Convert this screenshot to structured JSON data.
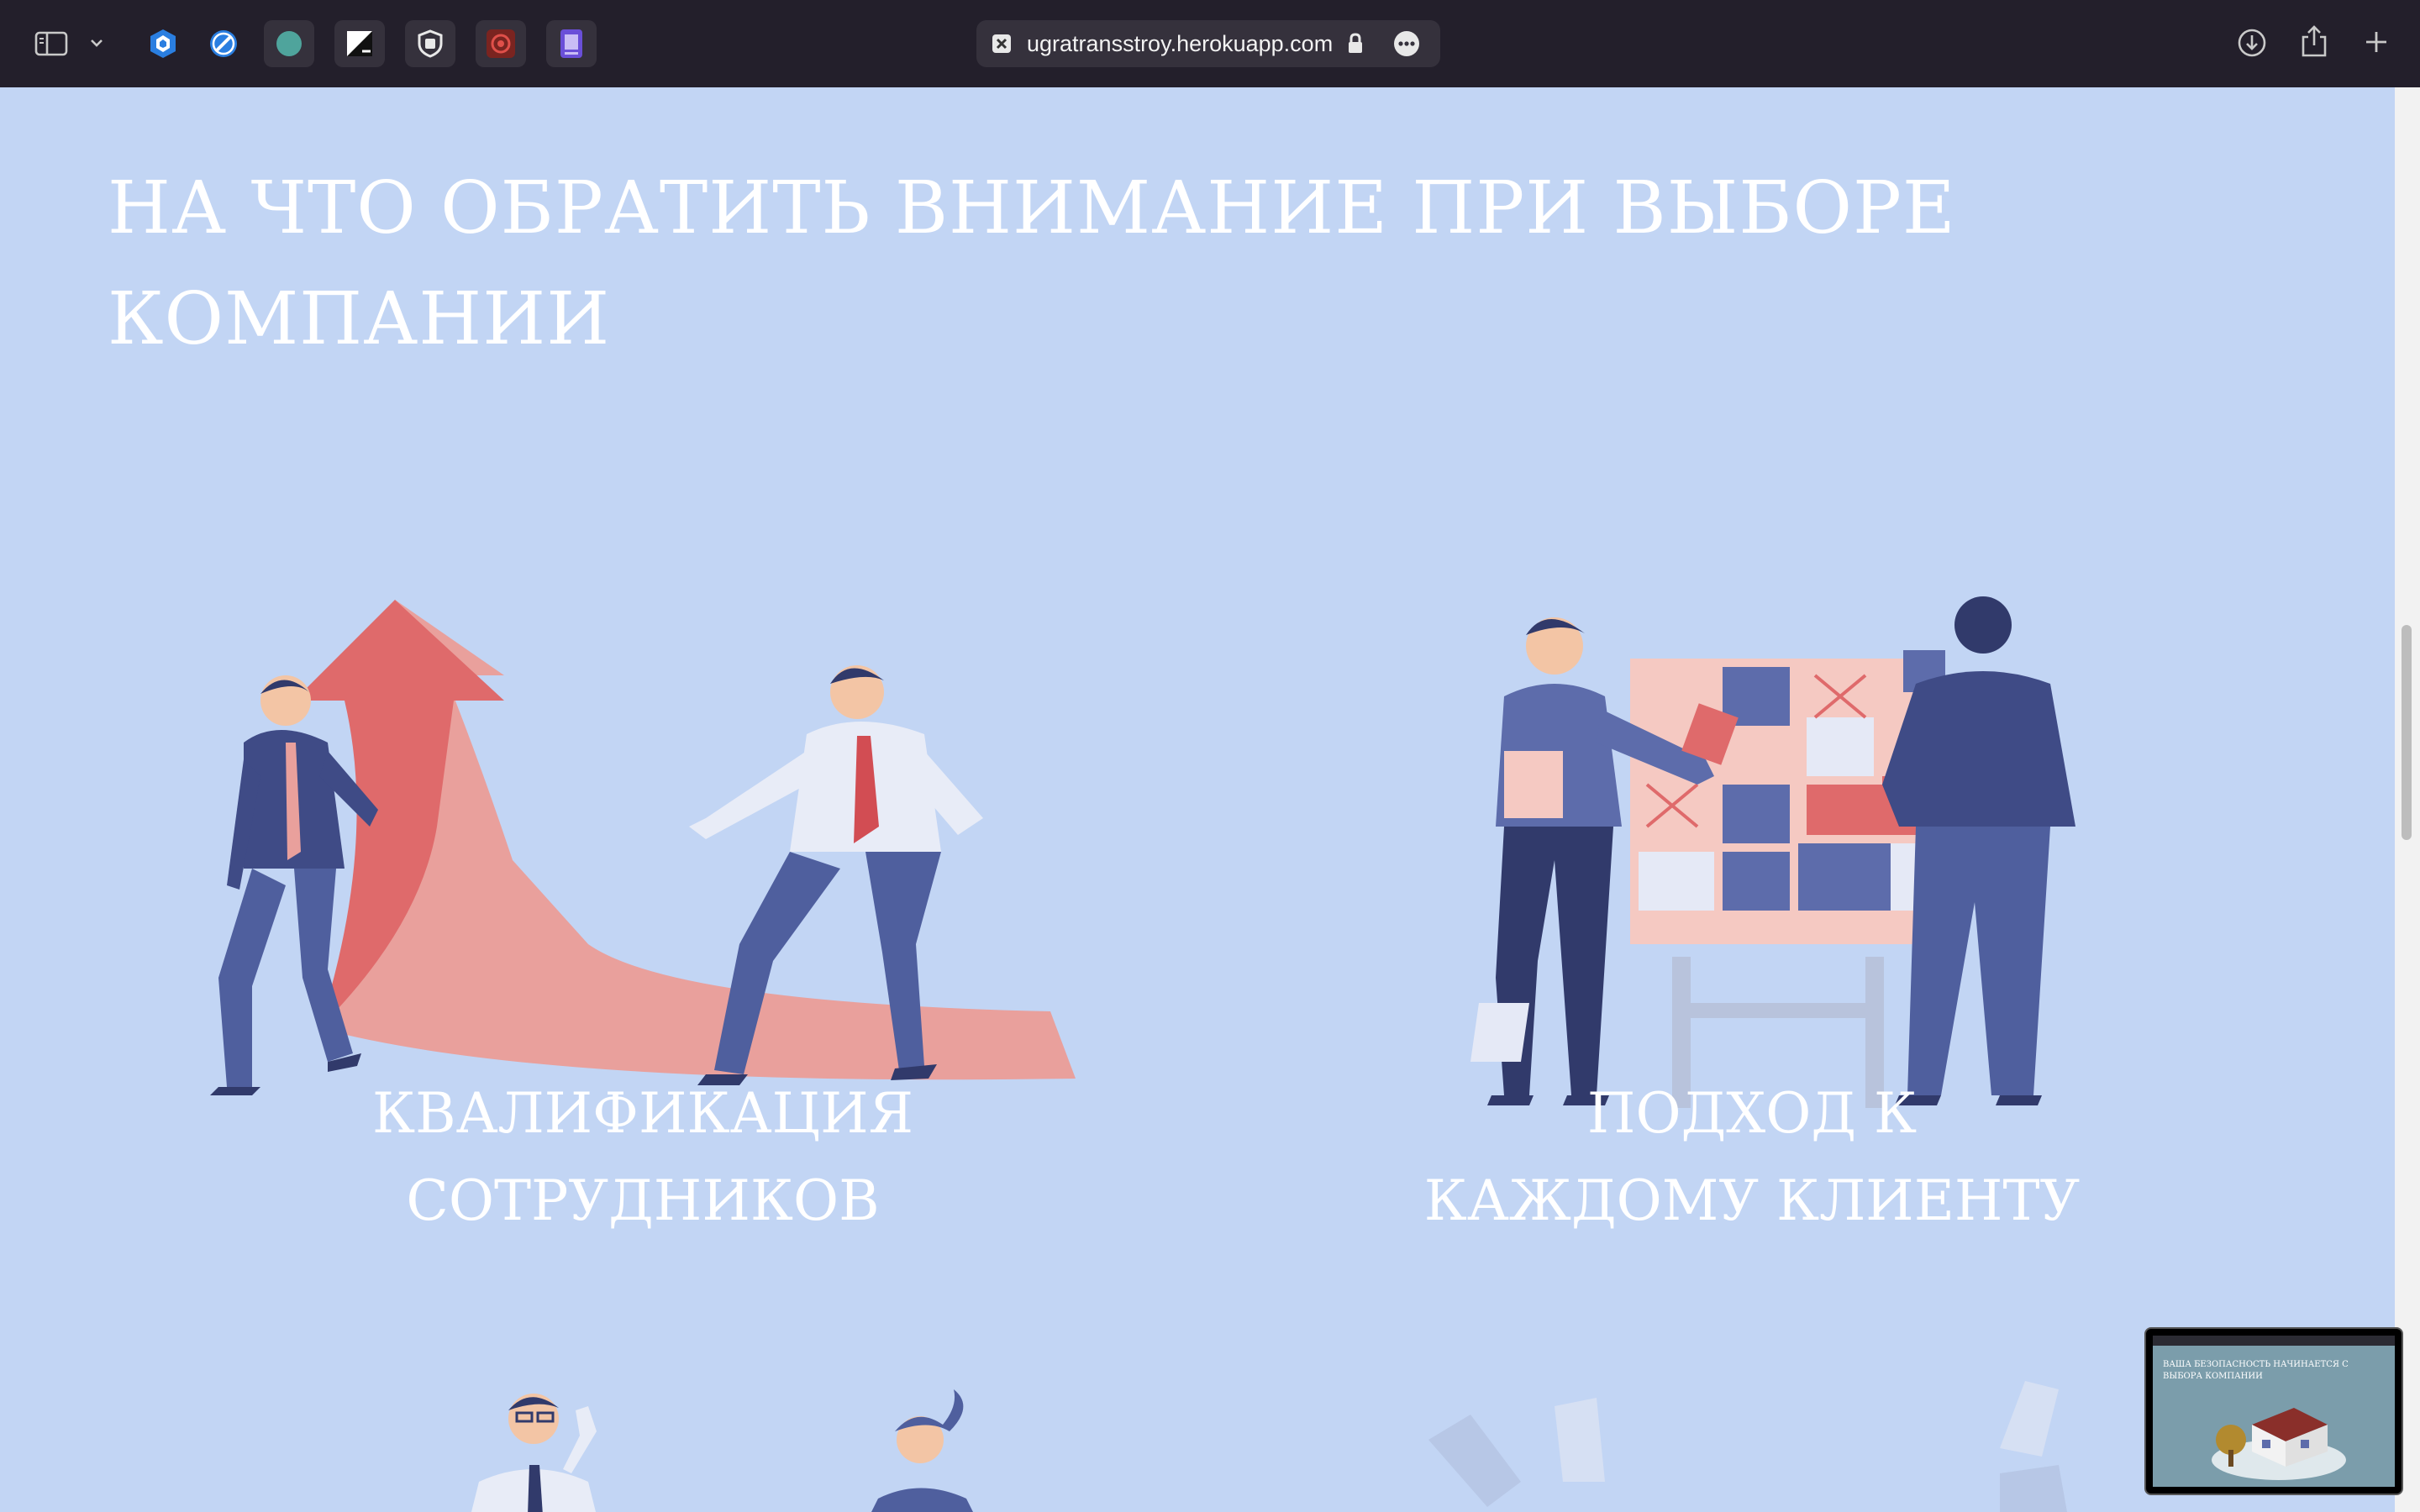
{
  "browser": {
    "url": "ugratransstroy.herokuapp.com",
    "extensions": [
      "hexagon-extension-icon",
      "compass-extension-icon",
      "green-circle-extension-icon",
      "contrast-extension-icon",
      "shield-extension-icon",
      "red-extension-icon",
      "purple-extension-icon"
    ]
  },
  "page": {
    "heading": "НА ЧТО ОБРАТИТЬ ВНИМАНИЕ ПРИ ВЫБОРЕ КОМПАНИИ",
    "features": [
      {
        "title_line1": "КВАЛИФИКАЦИЯ",
        "title_line2": "СОТРУДНИКОВ"
      },
      {
        "title_line1": "ПОДХОД К",
        "title_line2": "КАЖДОМУ КЛИЕНТУ"
      }
    ]
  },
  "pip_preview": {
    "text": "ВАША БЕЗОПАСНОСТЬ НАЧИНАЕТСЯ С ВЫБОРА КОМПАНИИ"
  },
  "colors": {
    "page_bg": "#c2d5f4",
    "toolbar_bg": "#231f2b",
    "accent_red": "#e06a6c",
    "suit_blue": "#4f5f9e"
  }
}
